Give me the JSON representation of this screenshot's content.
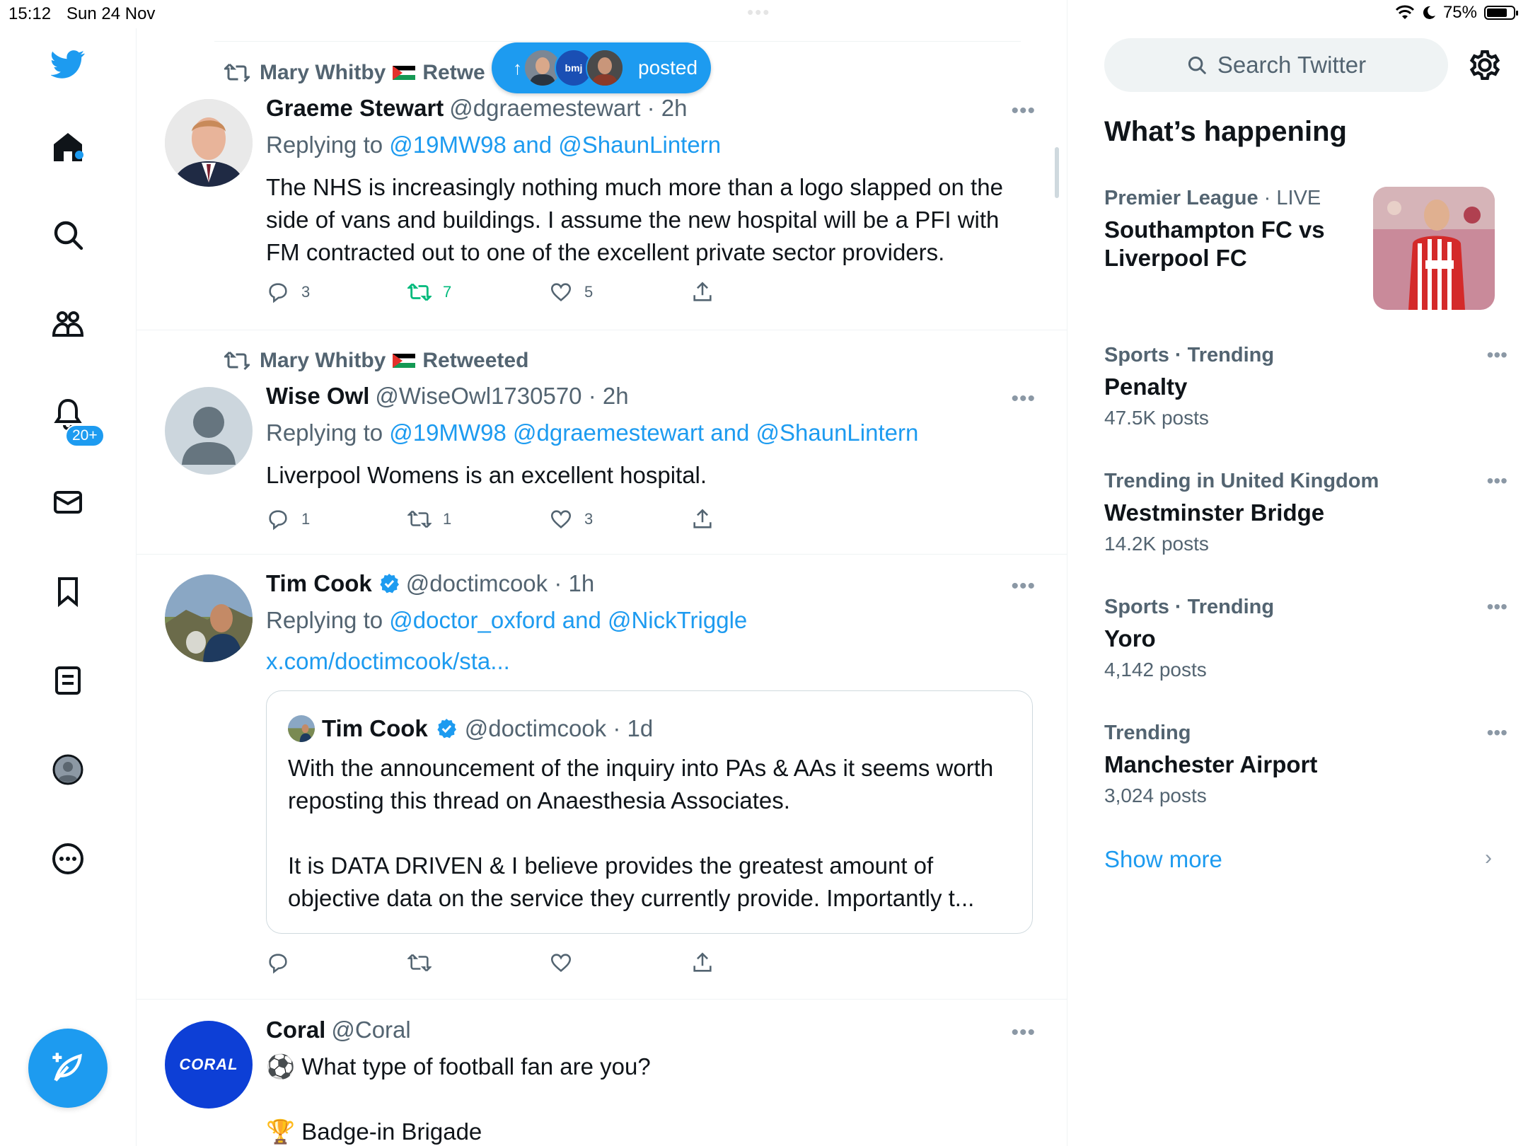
{
  "status_bar": {
    "time": "15:12",
    "date": "Sun 24 Nov",
    "battery": "75%",
    "multitask_dots": "•••"
  },
  "nav": {
    "notifications_badge": "20+",
    "icons": [
      "twitter-logo-icon",
      "home-icon",
      "search-icon",
      "communities-icon",
      "notifications-icon",
      "messages-icon",
      "bookmarks-icon",
      "lists-icon",
      "profile-icon",
      "more-icon",
      "compose-icon"
    ]
  },
  "new_posts_pill": {
    "label": "posted",
    "arrow": "↑",
    "mid_avatar_text": "bmj"
  },
  "tweets": [
    {
      "retweeted_by": "Mary Whitby",
      "retweet_label": "Retwe",
      "name": "Graeme Stewart",
      "handle_time": "@dgraemestewart · 2h",
      "replying_prefix": "Replying to",
      "replying_to": "@19MW98 and @ShaunLintern",
      "text": "The NHS is increasingly nothing much more than a logo slapped on the side of vans and buildings. I assume the new hospital will be a PFI with FM contracted out to one of the excellent private sector providers.",
      "replies": "3",
      "retweets": "7",
      "likes": "5"
    },
    {
      "retweeted_by": "Mary Whitby",
      "retweet_label": "Retweeted",
      "name": "Wise Owl",
      "handle_time": "@WiseOwl1730570 · 2h",
      "replying_prefix": "Replying to",
      "replying_to": "@19MW98 @dgraemestewart and @ShaunLintern",
      "text": "Liverpool Womens is an excellent hospital.",
      "replies": "1",
      "retweets": "1",
      "likes": "3"
    },
    {
      "name": "Tim Cook",
      "handle_time": "@doctimcook · 1h",
      "replying_prefix": "Replying to",
      "replying_to": "@doctor_oxford and @NickTriggle",
      "link": "x.com/doctimcook/sta...",
      "quote": {
        "name": "Tim Cook",
        "handle_time": "@doctimcook · 1d",
        "text1": "With the announcement of the inquiry into PAs & AAs it seems worth reposting this thread on Anaesthesia Associates.",
        "text2": "It is DATA DRIVEN & I believe provides the greatest amount of objective data on the service they currently provide. Importantly t..."
      }
    },
    {
      "name": "Coral",
      "handle": "@Coral",
      "avatar_text": "CORAL",
      "line1_emoji": "⚽",
      "line1": "What type of football fan are you?",
      "line2_emoji": "🏆",
      "line2": "Badge-in Brigade"
    }
  ],
  "right": {
    "search_placeholder": "Search Twitter",
    "heading": "What’s happening",
    "trends": [
      {
        "ctx_bold": "Premier League",
        "ctx_rest": " · LIVE",
        "title": "Southampton FC vs Liverpool FC",
        "count": ""
      },
      {
        "ctx_bold": "Sports · Trending",
        "ctx_rest": "",
        "title": "Penalty",
        "count": "47.5K posts"
      },
      {
        "ctx_bold": "Trending in United Kingdom",
        "ctx_rest": "",
        "title": "Westminster Bridge",
        "count": "14.2K posts"
      },
      {
        "ctx_bold": "Sports · Trending",
        "ctx_rest": "",
        "title": "Yoro",
        "count": "4,142 posts"
      },
      {
        "ctx_bold": "Trending",
        "ctx_rest": "",
        "title": "Manchester Airport",
        "count": "3,024 posts"
      }
    ],
    "show_more": "Show more",
    "show_more_chevron": "›",
    "trend_more": "•••"
  },
  "colors": {
    "accent": "#1d9bf0",
    "retweet_green": "#00ba7c",
    "muted": "#536471"
  }
}
